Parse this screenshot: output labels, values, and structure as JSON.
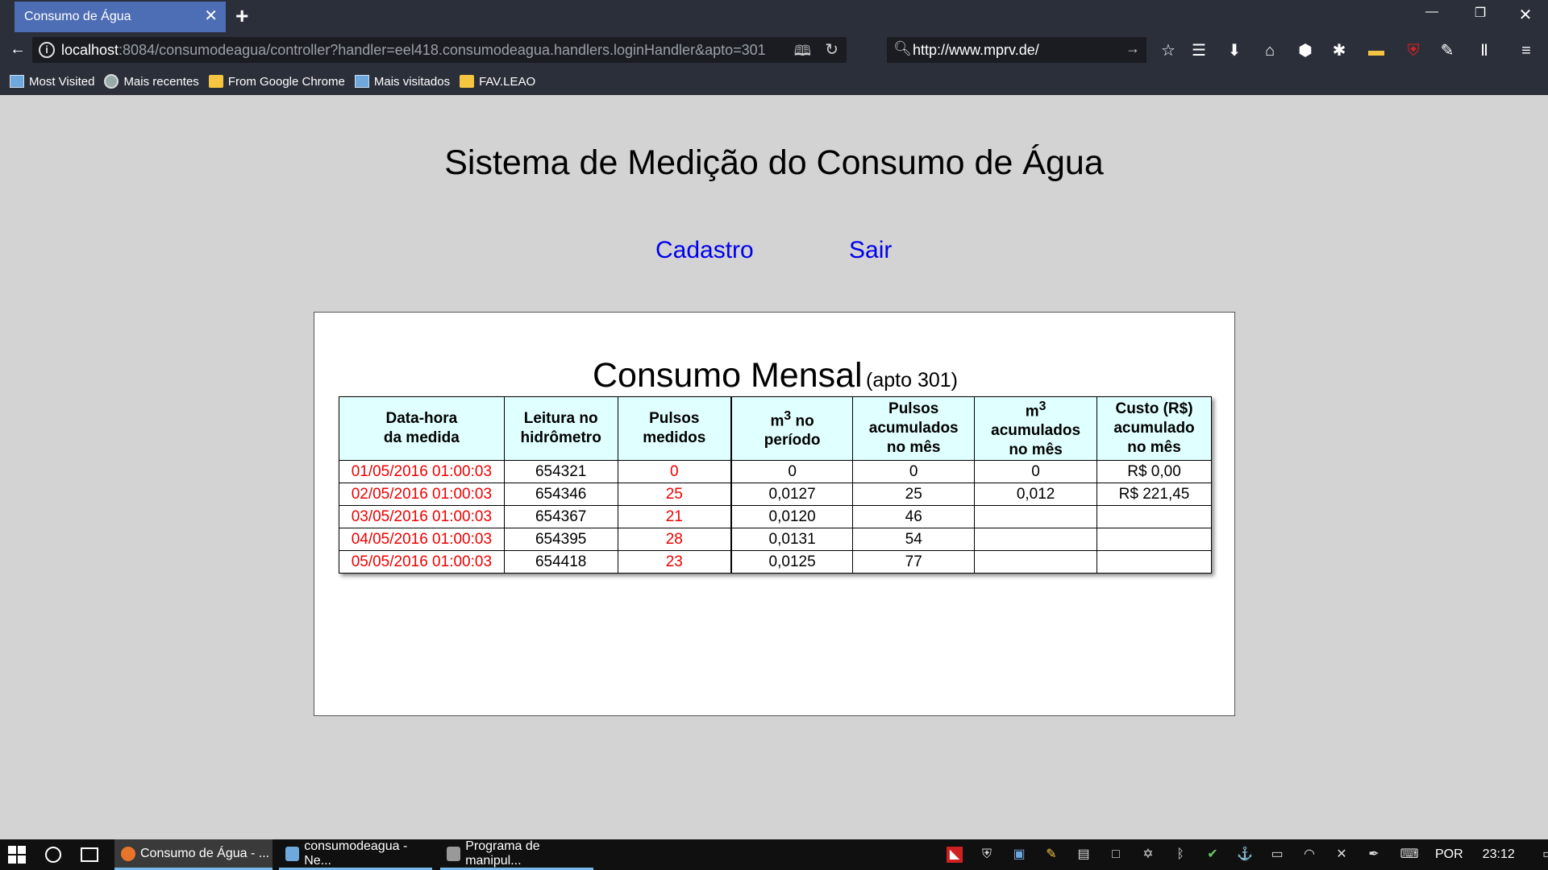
{
  "browser": {
    "tab_title": "Consumo de Água",
    "tab_close": "✕",
    "new_tab": "+",
    "url_host": "localhost",
    "url_rest": ":8084/consumodeagua/controller?handler=eel418.consumodeagua.handlers.loginHandler&apto=301",
    "search_value": "http://www.mprv.de/",
    "bookmarks": [
      {
        "label": "Most Visited",
        "icon": "page"
      },
      {
        "label": "Mais recentes",
        "icon": "globe"
      },
      {
        "label": "From Google Chrome",
        "icon": "folder"
      },
      {
        "label": "Mais visitados",
        "icon": "page"
      },
      {
        "label": "FAV.LEAO",
        "icon": "folder"
      }
    ]
  },
  "page": {
    "title": "Sistema de Medição do Consumo de Água",
    "links": {
      "cadastro": "Cadastro",
      "sair": "Sair"
    },
    "panel_title": "Consumo Mensal",
    "panel_subtitle": "(apto 301)"
  },
  "table": {
    "headers": {
      "datahora_1": "Data-hora",
      "datahora_2": "da medida",
      "leitura_1": "Leitura no",
      "leitura_2": "hidrômetro",
      "pulsos_1": "Pulsos",
      "pulsos_2": "medidos",
      "m3periodo_1": "m",
      "m3periodo_sup": "3",
      "m3periodo_2": " no",
      "m3periodo_3": "período",
      "pulsosacum_1": "Pulsos",
      "pulsosacum_2": "acumulados",
      "pulsosacum_3": "no mês",
      "m3acum_1": "m",
      "m3acum_sup": "3",
      "m3acum_2": "acumulados",
      "m3acum_3": "no mês",
      "custo_1": "Custo (R$)",
      "custo_2": "acumulado",
      "custo_3": "no mês"
    },
    "rows": [
      {
        "datahora": "01/05/2016 01:00:03",
        "leitura": "654321",
        "pulsos": "0",
        "m3": "0",
        "pulsos_acum": "0",
        "m3_acum": "0",
        "custo": "R$ 0,00"
      },
      {
        "datahora": "02/05/2016 01:00:03",
        "leitura": "654346",
        "pulsos": "25",
        "m3": "0,0127",
        "pulsos_acum": "25",
        "m3_acum": "0,012",
        "custo": "R$ 221,45"
      },
      {
        "datahora": "03/05/2016 01:00:03",
        "leitura": "654367",
        "pulsos": "21",
        "m3": "0,0120",
        "pulsos_acum": "46",
        "m3_acum": "",
        "custo": ""
      },
      {
        "datahora": "04/05/2016 01:00:03",
        "leitura": "654395",
        "pulsos": "28",
        "m3": "0,0131",
        "pulsos_acum": "54",
        "m3_acum": "",
        "custo": ""
      },
      {
        "datahora": "05/05/2016 01:00:03",
        "leitura": "654418",
        "pulsos": "23",
        "m3": "0,0125",
        "pulsos_acum": "77",
        "m3_acum": "",
        "custo": ""
      }
    ]
  },
  "taskbar": {
    "apps": [
      {
        "label": "Consumo de Água - ...",
        "icon_color": "#e8742b"
      },
      {
        "label": "consumodeagua - Ne...",
        "icon_color": "#6fa8dc"
      },
      {
        "label": "Programa de manipul...",
        "icon_color": "#999999"
      }
    ],
    "language": "POR",
    "time": "23:12"
  },
  "colors": {
    "page_bg": "#d3d3d3",
    "link": "#0000ee",
    "date_red": "#ee0000",
    "header_bg": "#e0ffff",
    "chrome_bg": "#2b2f3a",
    "active_tab": "#4d6db4"
  }
}
